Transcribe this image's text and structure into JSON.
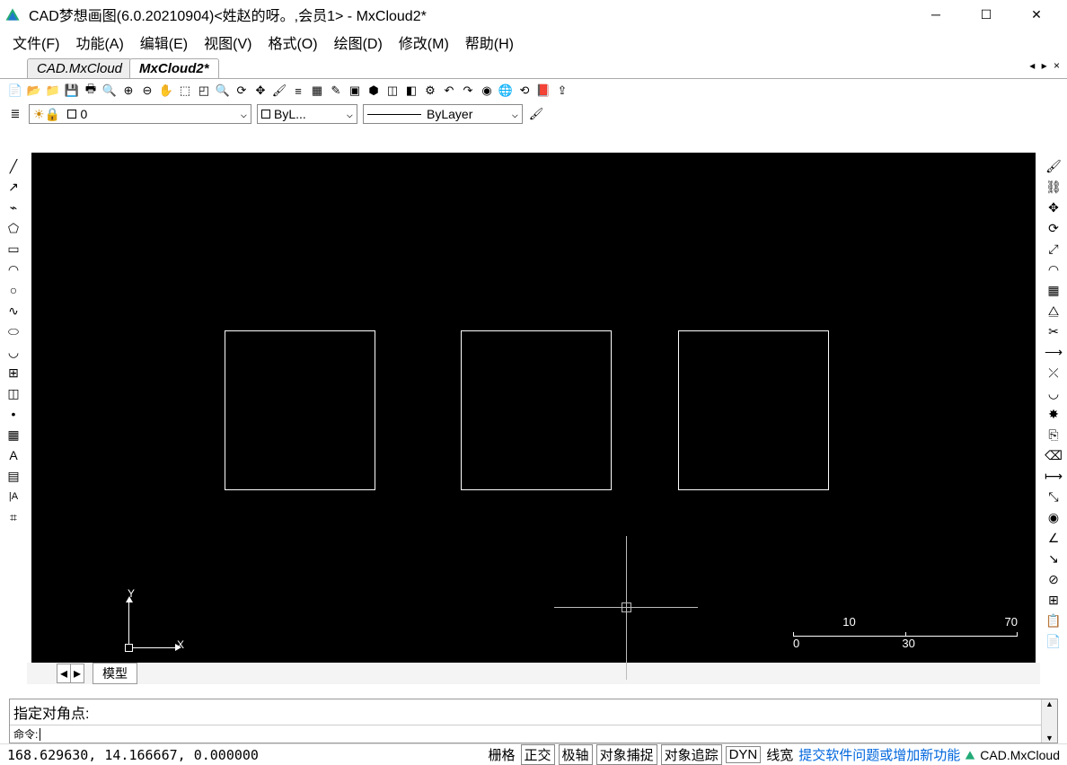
{
  "window": {
    "title": "CAD梦想画图(6.0.20210904)<姓赵的呀。,会员1> - MxCloud2*"
  },
  "menu": {
    "file": "文件(F)",
    "function": "功能(A)",
    "edit": "编辑(E)",
    "view": "视图(V)",
    "format": "格式(O)",
    "draw": "绘图(D)",
    "modify": "修改(M)",
    "help": "帮助(H)"
  },
  "doc_tabs": {
    "tab1": "CAD.MxCloud",
    "tab2": "MxCloud2*"
  },
  "layer_bar": {
    "layer": "0",
    "color": "ByL...",
    "linetype": "ByLayer"
  },
  "model_tab": "模型",
  "command": {
    "history": "指定对角点:",
    "prompt": "命令:"
  },
  "status": {
    "coords": "168.629630, 14.166667, 0.000000",
    "grid": "栅格",
    "ortho": "正交",
    "polar": "极轴",
    "osnap": "对象捕捉",
    "otrack": "对象追踪",
    "dyn": "DYN",
    "lwt": "线宽",
    "feedback": "提交软件问题或增加新功能",
    "brand": "CAD.MxCloud"
  },
  "ucs": {
    "x": "X",
    "y": "Y"
  },
  "scale": {
    "l": "0",
    "tl": "10",
    "m": "30",
    "tr": "70"
  }
}
